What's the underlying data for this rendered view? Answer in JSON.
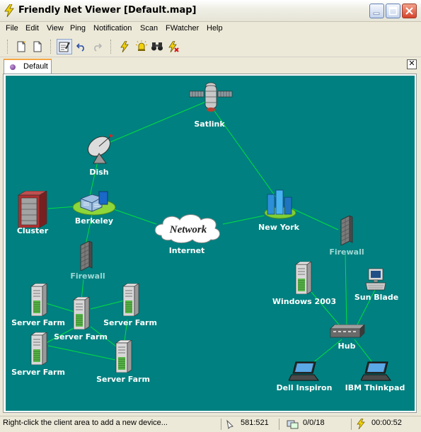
{
  "window": {
    "title": "Friendly Net Viewer [Default.map]"
  },
  "menu": [
    "File",
    "Edit",
    "View",
    "Ping",
    "Notification",
    "Scan",
    "FWatcher",
    "Help"
  ],
  "toolbar": {
    "buttons": [
      "new-icon",
      "new-map-icon",
      "edit-icon",
      "undo-icon",
      "redo-icon",
      "lightning-icon",
      "alarm-icon",
      "binoculars-icon",
      "lightning-stop-icon"
    ]
  },
  "tabs": [
    {
      "label": "Default",
      "active": true
    }
  ],
  "colors": {
    "map_background": "#008080",
    "link": "#00e040",
    "label": "#ffffff"
  },
  "map": {
    "nodes": {
      "satlink": {
        "label": "Satlink",
        "icon": "satellite-icon"
      },
      "dish": {
        "label": "Dish",
        "icon": "satellite-dish-icon"
      },
      "cluster": {
        "label": "Cluster",
        "icon": "server-rack-icon"
      },
      "berkeley": {
        "label": "Berkeley",
        "icon": "campus-icon"
      },
      "network": {
        "label": "Network",
        "sublabel": "Internet",
        "icon": "cloud-icon"
      },
      "newyork": {
        "label": "New York",
        "icon": "city-icon"
      },
      "firewall_left": {
        "label": "Firewall",
        "icon": "firewall-icon"
      },
      "firewall_right": {
        "label": "Firewall",
        "icon": "firewall-icon"
      },
      "sf1": {
        "label": "Server Farm",
        "icon": "server-icon"
      },
      "sf2": {
        "label": "Server Farm",
        "icon": "server-icon"
      },
      "sf3": {
        "label": "Server Farm",
        "icon": "server-icon"
      },
      "sf4": {
        "label": "Server Farm",
        "icon": "server-icon"
      },
      "sf5": {
        "label": "Server Farm",
        "icon": "server-icon"
      },
      "win2003": {
        "label": "Windows 2003",
        "icon": "server-icon"
      },
      "sunblade": {
        "label": "Sun Blade",
        "icon": "workstation-icon"
      },
      "hub": {
        "label": "Hub",
        "icon": "hub-icon"
      },
      "dell": {
        "label": "Dell Inspiron",
        "icon": "laptop-icon"
      },
      "ibm": {
        "label": "IBM Thinkpad",
        "icon": "laptop-icon"
      }
    }
  },
  "status": {
    "hint": "Right-click the client area to add a new device...",
    "coords": "581:521",
    "counts": "0/0/18",
    "time": "00:00:52"
  }
}
